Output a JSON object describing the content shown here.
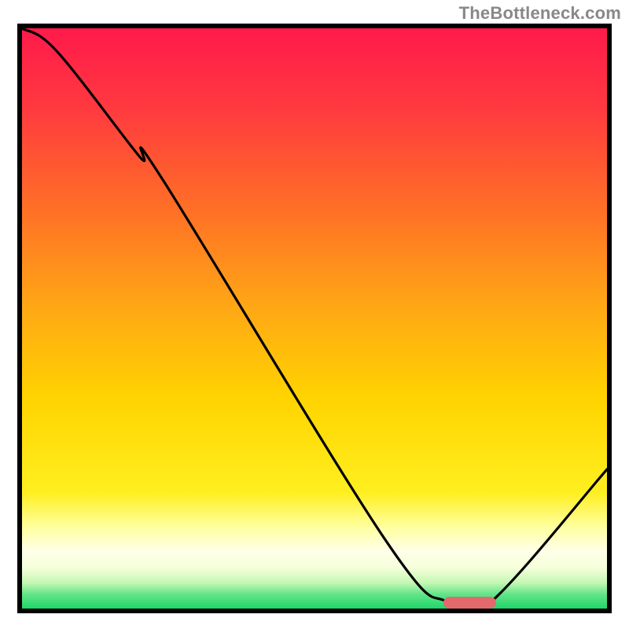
{
  "attribution": "TheBottleneck.com",
  "colors": {
    "frame": "#000000",
    "marker": "#e26a6d",
    "curve": "#000000",
    "top": "#ff1a4b",
    "mid": "#ffd400",
    "green": "#1fd66b",
    "white_band": "#ffffd0"
  },
  "chart_data": {
    "type": "line",
    "title": "",
    "xlabel": "",
    "ylabel": "",
    "xlim": [
      0,
      100
    ],
    "ylim": [
      0,
      100
    ],
    "series": [
      {
        "name": "bottleneck-curve",
        "x": [
          0,
          6,
          20,
          24,
          62,
          73,
          80,
          100
        ],
        "y": [
          100,
          96,
          78,
          74,
          12,
          1,
          1,
          24
        ]
      }
    ],
    "marker": {
      "x_start": 72,
      "x_end": 81,
      "y": 1
    },
    "notes": "y axis is inverted in rendering (0 at bottom, 100 at top). Curve estimated from pixels; no axis ticks shown."
  }
}
